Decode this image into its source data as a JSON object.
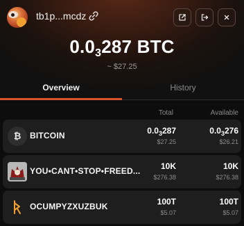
{
  "wallet": {
    "address": "tb1p...mcdz",
    "balance": {
      "main": "0.0",
      "sub": "3",
      "rest": "287 BTC"
    },
    "usd": "~ $27.25"
  },
  "tabs": [
    {
      "label": "Overview",
      "active": true
    },
    {
      "label": "History",
      "active": false
    }
  ],
  "columns": {
    "total": "Total",
    "available": "Available"
  },
  "tokens": [
    {
      "name": "BITCOIN",
      "icon": "bitcoin-icon",
      "total": {
        "main": "0.0",
        "sub": "3",
        "rest": "287"
      },
      "total_usd": "$27.25",
      "available": {
        "main": "0.0",
        "sub": "3",
        "rest": "276"
      },
      "available_usd": "$26.21"
    },
    {
      "name": "YOU•CANT•STOP•FREED...",
      "icon": "rune-image-icon",
      "total": {
        "main": "10K",
        "sub": "",
        "rest": ""
      },
      "total_usd": "$276.38",
      "available": {
        "main": "10K",
        "sub": "",
        "rest": ""
      },
      "available_usd": "$276.38"
    },
    {
      "name": "OCUMPYZXUZBUK",
      "icon": "rune-symbol-icon",
      "total": {
        "main": "100T",
        "sub": "",
        "rest": ""
      },
      "total_usd": "$5.07",
      "available": {
        "main": "100T",
        "sub": "",
        "rest": ""
      },
      "available_usd": "$5.07"
    }
  ],
  "colors": {
    "accent": "#d9542b",
    "row_bg": "#1e1e1e",
    "background": "#0d0d0d"
  }
}
